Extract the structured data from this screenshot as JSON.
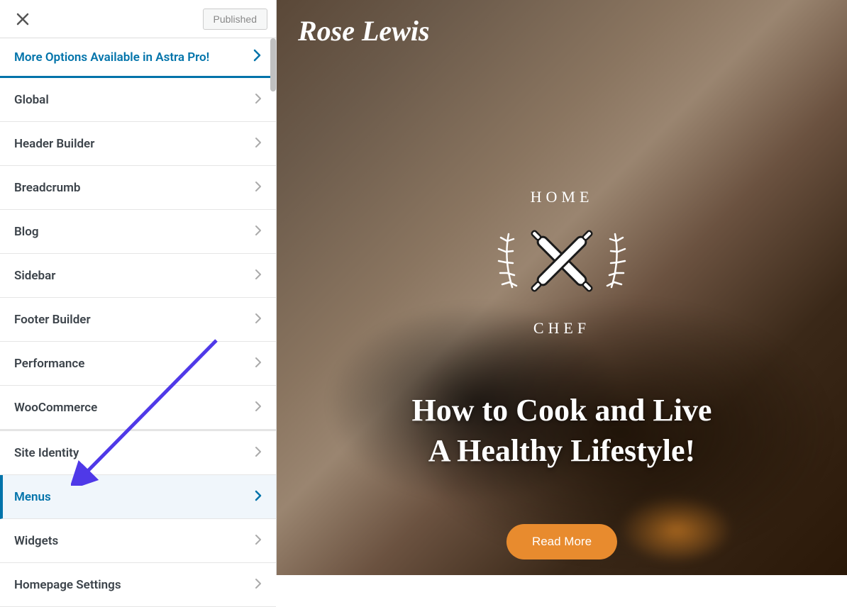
{
  "header": {
    "published_label": "Published"
  },
  "sidebar": {
    "promo_label": "More Options Available in Astra Pro!",
    "section1": [
      {
        "label": "Global"
      },
      {
        "label": "Header Builder"
      },
      {
        "label": "Breadcrumb"
      },
      {
        "label": "Blog"
      },
      {
        "label": "Sidebar"
      },
      {
        "label": "Footer Builder"
      },
      {
        "label": "Performance"
      },
      {
        "label": "WooCommerce"
      }
    ],
    "section2": [
      {
        "label": "Site Identity"
      },
      {
        "label": "Menus",
        "active": true
      },
      {
        "label": "Widgets"
      },
      {
        "label": "Homepage Settings"
      }
    ]
  },
  "preview": {
    "site_title": "Rose Lewis",
    "badge_top": "HOME",
    "badge_bottom": "CHEF",
    "heading_line1": "How to Cook and Live",
    "heading_line2": "A Healthy Lifestyle!",
    "button_label": "Read More"
  },
  "colors": {
    "accent": "#0073aa",
    "button": "#e88b2e",
    "arrow": "#4f39e8"
  }
}
